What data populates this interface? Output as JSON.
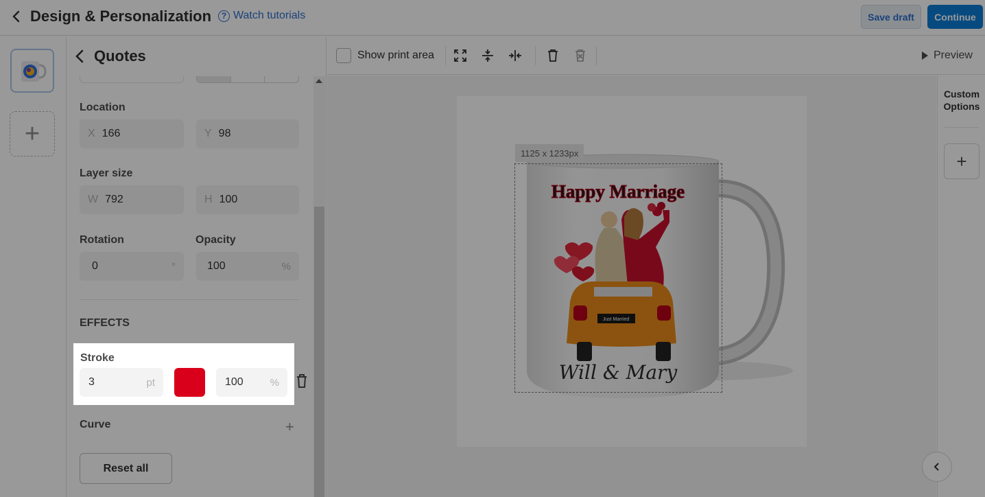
{
  "header": {
    "title": "Design & Personalization",
    "tutorials_label": "Watch tutorials",
    "save_draft_label": "Save draft",
    "continue_label": "Continue"
  },
  "panel": {
    "title": "Quotes",
    "location_label": "Location",
    "location": {
      "x_prefix": "X",
      "x": "166",
      "y_prefix": "Y",
      "y": "98"
    },
    "layer_size_label": "Layer size",
    "layer_size": {
      "w_prefix": "W",
      "w": "792",
      "h_prefix": "H",
      "h": "100"
    },
    "rotation_label": "Rotation",
    "rotation": {
      "value": "0",
      "unit": "°"
    },
    "opacity_label": "Opacity",
    "opacity": {
      "value": "100",
      "unit": "%"
    },
    "effects_label": "EFFECTS",
    "stroke_label": "Stroke",
    "stroke": {
      "width": "3",
      "unit": "pt",
      "color": "#d9001b",
      "opacity": "100",
      "opacity_unit": "%"
    },
    "curve_label": "Curve",
    "curve_add_symbol": "+",
    "reset_label": "Reset all"
  },
  "toolbar": {
    "show_print_area_label": "Show print area",
    "show_print_area_checked": false,
    "icons": [
      "fit-to-area-icon",
      "align-vertical-center-icon",
      "align-horizontal-center-icon",
      "delete-layer-icon",
      "delete-all-icon"
    ],
    "preview_label": "Preview"
  },
  "canvas": {
    "size_badge": "1125 x 1233px",
    "mug_text_top": "Happy Marriage",
    "mug_text_bottom": "Will & Mary",
    "plate_text": "Just Married"
  },
  "right_panel": {
    "custom_options_line1": "Custom",
    "custom_options_line2": "Options",
    "add_symbol": "+"
  },
  "rail": {
    "add_symbol": "+"
  }
}
